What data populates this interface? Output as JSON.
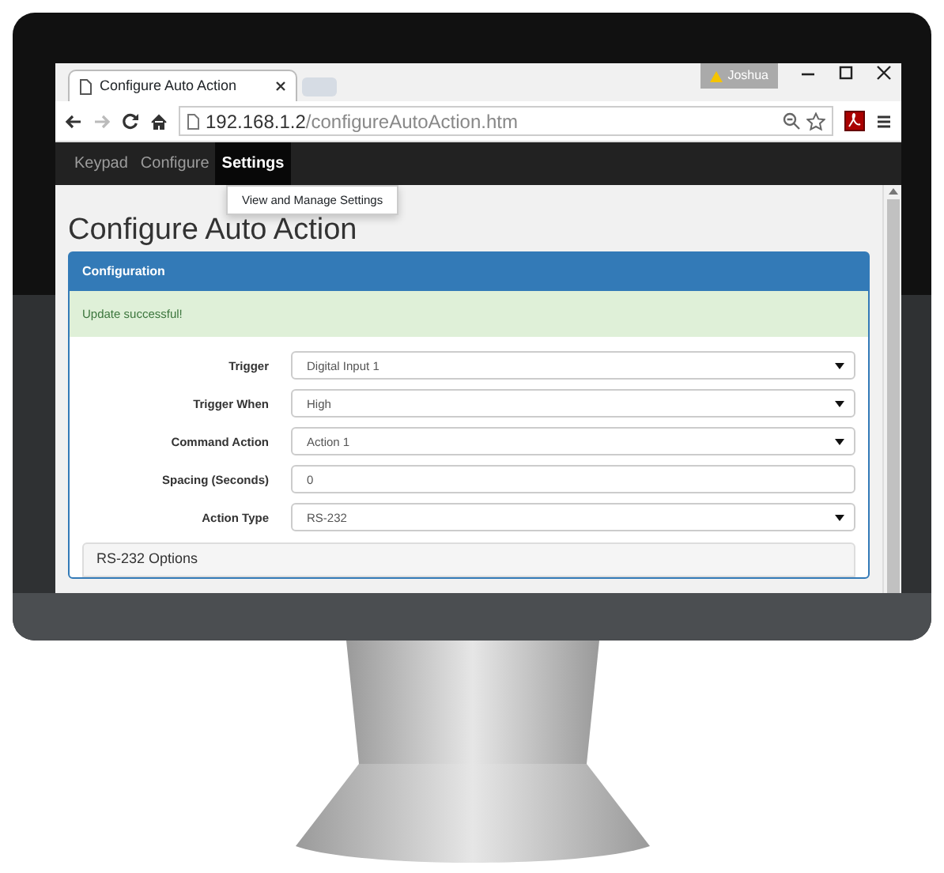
{
  "browser": {
    "user": "Joshua",
    "tabs": [
      {
        "title": "Configure Auto Action",
        "selected": true
      }
    ],
    "address": {
      "host": "192.168.1.2",
      "path": "/configureAutoAction.htm"
    }
  },
  "navbar": {
    "items": [
      {
        "label": "Keypad",
        "selected": false
      },
      {
        "label": "Configure",
        "selected": false
      },
      {
        "label": "Settings",
        "selected": true
      }
    ],
    "dropdown": [
      "View and Manage Settings"
    ]
  },
  "page": {
    "title": "Configure Auto Action",
    "panel_title": "Configuration",
    "alert": "Update successful!",
    "fields": [
      {
        "label": "Trigger",
        "kind": "select",
        "value": "Digital Input 1"
      },
      {
        "label": "Trigger When",
        "kind": "select",
        "value": "High"
      },
      {
        "label": "Command Action",
        "kind": "select",
        "value": "Action 1"
      },
      {
        "label": "Spacing (Seconds)",
        "kind": "input",
        "value": "0"
      },
      {
        "label": "Action Type",
        "kind": "select",
        "value": "RS-232"
      }
    ],
    "subpanel_title": "RS-232 Options"
  }
}
